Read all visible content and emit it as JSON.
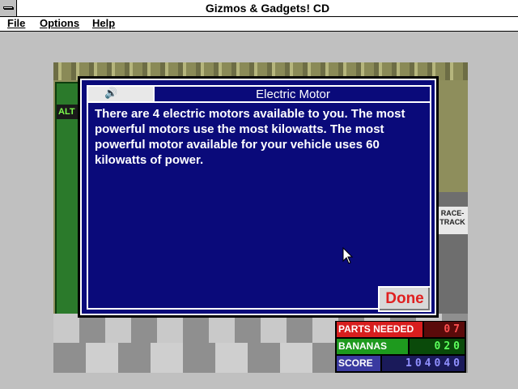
{
  "window": {
    "title": "Gizmos & Gadgets! CD"
  },
  "menubar": {
    "items": [
      {
        "label": "File"
      },
      {
        "label": "Options"
      },
      {
        "label": "Help"
      }
    ]
  },
  "scene": {
    "left_sign": "ALT",
    "right_sign": "RACE-\nTRACK"
  },
  "dialog": {
    "title": "Electric Motor",
    "speaker_glyph": "🔊",
    "body": "There are 4 electric motors available to you.  The most powerful motors use the most kilowatts.  The most powerful motor available for your vehicle uses 60 kilowatts of power.",
    "done_label": "Done"
  },
  "status": {
    "parts_needed_label": "PARTS NEEDED",
    "parts_needed_value": "07",
    "bananas_label": "BANANAS",
    "bananas_value": "020",
    "score_label": "SCORE",
    "score_value": "104040",
    "colors": {
      "parts": "#d81e1e",
      "bananas": "#1e9a1e",
      "score": "#3a3aa0"
    }
  }
}
